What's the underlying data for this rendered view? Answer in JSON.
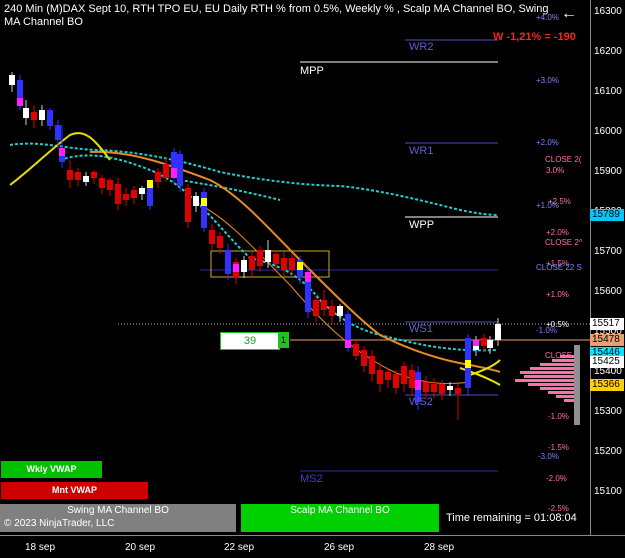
{
  "header": {
    "title": "240 Min (M)DAX Sept 10, RTH TPO EU, EU Daily RTH % from 0.5%, Weekly % , Scalp MA Channel BO, Swing MA Channel BO",
    "w_label": "W -1,21% = -190",
    "back_icon": "arrow-left-icon"
  },
  "price_axis": {
    "ticks": [
      "16300",
      "16200",
      "16100",
      "16000",
      "15900",
      "15800",
      "15700",
      "15600",
      "15500",
      "15400",
      "15300",
      "15200",
      "15100"
    ],
    "tags": [
      {
        "value": "15789",
        "color": "#00c8ff"
      },
      {
        "value": "15517",
        "color": "#ffffff"
      },
      {
        "value": "15478",
        "color": "#e8a070"
      },
      {
        "value": "15446",
        "color": "#00e8ff"
      },
      {
        "value": "15425",
        "color": "#ffffff"
      },
      {
        "value": "15366",
        "color": "#ffd000"
      }
    ]
  },
  "date_axis": {
    "labels": [
      "18 sep",
      "20 sep",
      "22 sep",
      "26 sep",
      "28 sep"
    ]
  },
  "levels": {
    "wr2": "WR2",
    "mpp": "MPP",
    "wr1": "WR1",
    "wpp": "WPP",
    "ws1": "WS1",
    "ws2": "WS2",
    "ms2": "MS2"
  },
  "pct_labels_weekly": [
    "+4.0%",
    "+3.0%",
    "+2.0%",
    "+1.0%",
    "+0.5%",
    "-1.0%",
    "-2.0%",
    "-3.0%"
  ],
  "pct_labels_daily": [
    "+2.5%",
    "+2.0%",
    "+1.5%",
    "+1.0%",
    "+0.5%",
    "-1.0%",
    "-1.5%",
    "-2.0%",
    "-2.5%"
  ],
  "close_labels": [
    "CLOSE 2(",
    "3.0%",
    "CLOSE 2^",
    "CLOSE 22 S",
    "CLOSE"
  ],
  "counter": {
    "value": "39",
    "badge": "1"
  },
  "vwap": {
    "weekly": "Wkly VWAP",
    "monthly": "Mnt VWAP"
  },
  "bottom": {
    "swing": "Swing MA Channel BO",
    "copyright": "© 2023 NinjaTrader, LLC",
    "scalp": "Scalp MA Channel BO",
    "time_remaining": "Time remaining = 01:08:04"
  },
  "colors": {
    "up_candle": "#ffffff",
    "down_candle": "#e00000",
    "highlight_blue": "#3030ff",
    "magenta": "#ff20ff",
    "cyan_ma": "#20d0d0",
    "orange_ma": "#e88a20",
    "yellow_ma": "#e8e000"
  }
}
